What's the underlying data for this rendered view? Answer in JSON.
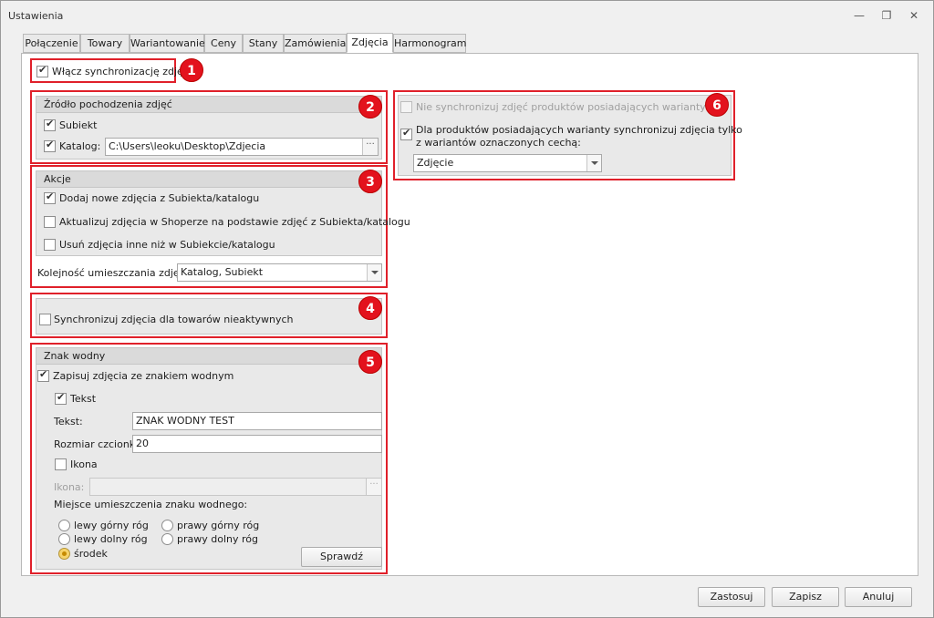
{
  "window": {
    "title": "Ustawienia",
    "controls": [
      "minimize-icon",
      "restore-icon",
      "close-icon"
    ]
  },
  "tabs": [
    {
      "label": "Połączenie"
    },
    {
      "label": "Towary"
    },
    {
      "label": "Wariantowanie"
    },
    {
      "label": "Ceny"
    },
    {
      "label": "Stany"
    },
    {
      "label": "Zamówienia"
    },
    {
      "label": "Zdjęcia"
    },
    {
      "label": "Harmonogram"
    }
  ],
  "active_tab": "Zdjęcia",
  "enable_sync": {
    "label": "Włącz synchronizację zdjęć",
    "checked": true
  },
  "source": {
    "header": "Źródło pochodzenia zdjęć",
    "subiekt": {
      "label": "Subiekt",
      "checked": true
    },
    "catalog": {
      "label": "Katalog:",
      "checked": true,
      "path": "C:\\Users\\leoku\\Desktop\\Zdjecia",
      "browse": "···"
    }
  },
  "actions": {
    "header": "Akcje",
    "add_new": {
      "label": "Dodaj nowe zdjęcia z Subiekta/katalogu",
      "checked": true
    },
    "update": {
      "label": "Aktualizuj zdjęcia w Shoperze na podstawie zdjęć z Subiekta/katalogu",
      "checked": false
    },
    "remove": {
      "label": "Usuń zdjęcia inne niż w Subiekcie/katalogu",
      "checked": false
    },
    "order_label": "Kolejność umieszczania zdjęć:",
    "order_value": "Katalog, Subiekt"
  },
  "inactive": {
    "label": "Synchronizuj zdjęcia dla towarów nieaktywnych",
    "checked": false
  },
  "watermark": {
    "header": "Znak wodny",
    "save_with": {
      "label": "Zapisuj zdjęcia ze znakiem wodnym",
      "checked": true
    },
    "text_toggle": {
      "label": "Tekst",
      "checked": true
    },
    "text_label": "Tekst:",
    "text_value": "ZNAK WODNY TEST",
    "font_size_label": "Rozmiar czcionki:",
    "font_size_value": "20",
    "icon_toggle": {
      "label": "Ikona",
      "checked": false
    },
    "icon_label": "Ikona:",
    "icon_value": "",
    "icon_browse": "···",
    "placement_label": "Miejsce umieszczenia znaku wodnego:",
    "placements": {
      "top_left": "lewy górny róg",
      "top_right": "prawy górny róg",
      "bottom_left": "lewy dolny róg",
      "bottom_right": "prawy dolny róg",
      "center": "środek"
    },
    "selected_placement": "środek",
    "check_button": "Sprawdź"
  },
  "variants": {
    "no_sync": {
      "label": "Nie synchronizuj zdjęć produktów posiadających warianty",
      "checked": false
    },
    "sync_marked": {
      "label_line1": "Dla produktów posiadających warianty synchronizuj zdjęcia tylko",
      "label_line2": "z wariantów oznaczonych cechą:",
      "checked": true
    },
    "feature_value": "Zdjęcie"
  },
  "badges": [
    "1",
    "2",
    "3",
    "4",
    "5",
    "6"
  ],
  "footer": {
    "apply": "Zastosuj",
    "save": "Zapisz",
    "cancel": "Anuluj"
  },
  "colors": {
    "annotation_red": "#e0202a",
    "selected_radio": "#f6d36b"
  }
}
